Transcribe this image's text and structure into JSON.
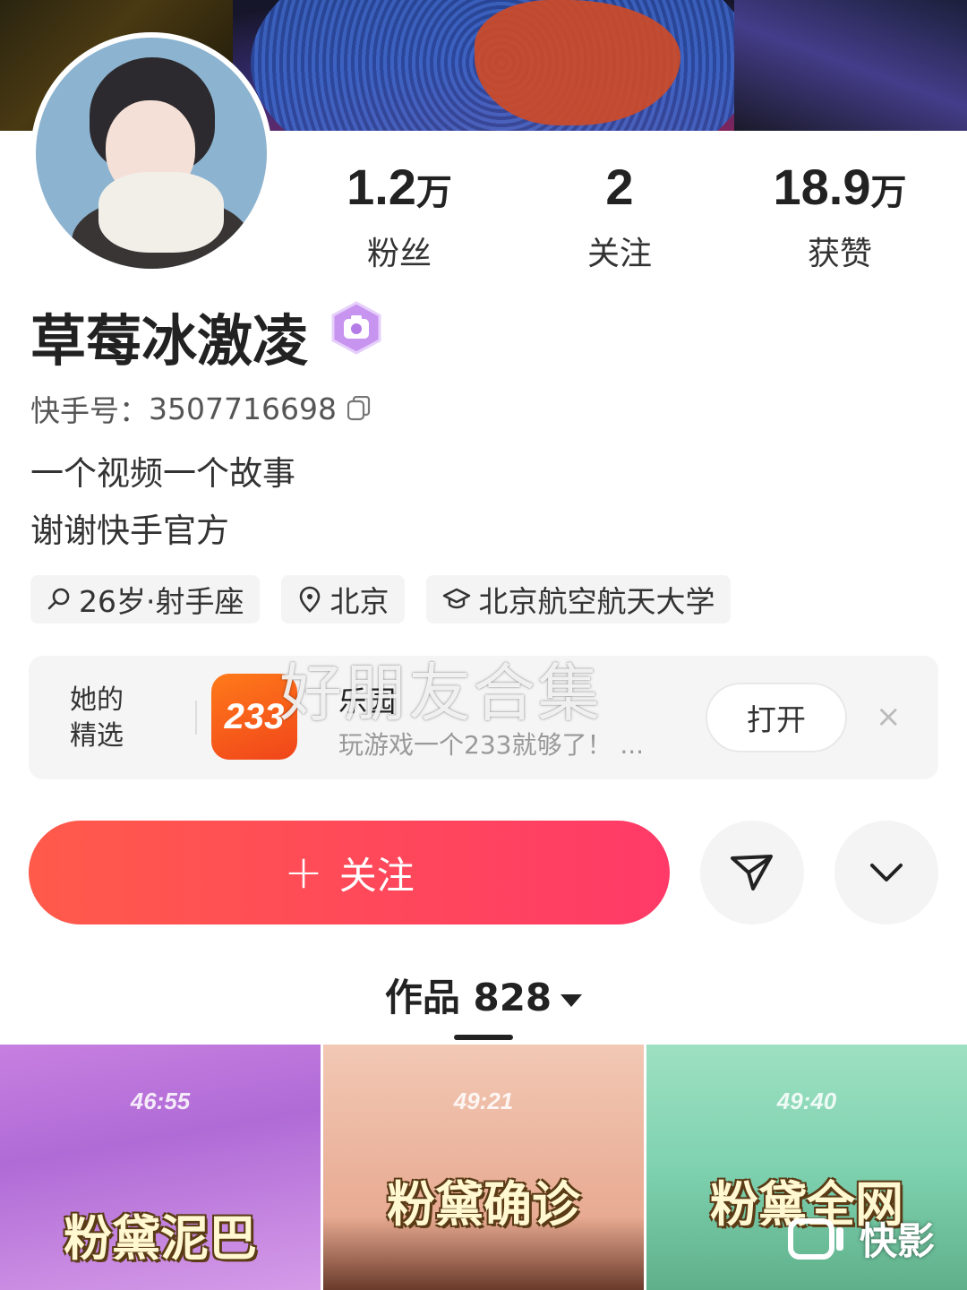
{
  "profile": {
    "name": "草莓冰激凌",
    "kuaishou_id_label": "快手号：",
    "kuaishou_id": "3507716698",
    "bio_line1": "一个视频一个故事",
    "bio_line2": "谢谢快手官方"
  },
  "stats": {
    "fans": {
      "num": "1.2",
      "unit": "万",
      "label": "粉丝"
    },
    "following": {
      "num": "2",
      "unit": "",
      "label": "关注"
    },
    "likes": {
      "num": "18.9",
      "unit": "万",
      "label": "获赞"
    }
  },
  "tags": {
    "age": "26岁·射手座",
    "location": "北京",
    "school": "北京航空航天大学"
  },
  "featured": {
    "section_label_line1": "她的",
    "section_label_line2": "精选",
    "app_icon_text": "233",
    "app_name": "乐园",
    "app_desc": "玩游戏一个233就够了！ ...",
    "open_label": "打开",
    "close_glyph": "×"
  },
  "watermark": "好朋友合集",
  "actions": {
    "follow_label": "关注",
    "plus_glyph": "+"
  },
  "works": {
    "label": "作品",
    "count": "828"
  },
  "thumbnails": [
    {
      "timer": "46:55",
      "title": "粉黛泥巴"
    },
    {
      "timer": "49:21",
      "title": "粉黛确诊"
    },
    {
      "timer": "49:40",
      "title": "粉黛全网"
    }
  ],
  "overlay_logo": "快影",
  "icons": [
    "copy-icon",
    "search-icon",
    "location-icon",
    "school-icon",
    "share-icon",
    "chevron-down-icon",
    "verified-badge-icon"
  ],
  "colors": {
    "follow_start": "#ff5a4a",
    "follow_end": "#ff3a68",
    "badge": "#b57ce8"
  }
}
